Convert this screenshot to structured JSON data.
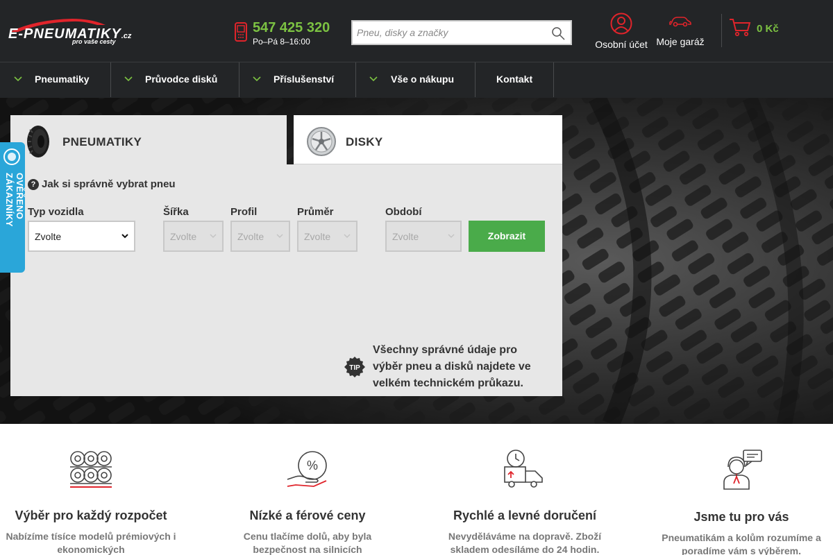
{
  "header": {
    "logo_text": "E-PNEUMATIKY",
    "logo_tld": ".cz",
    "logo_slogan": "pro vaše cesty",
    "phone_number": "547 425 320",
    "phone_hours": "Po–Pá 8–16:00",
    "search_placeholder": "Pneu, disky a značky",
    "account_label": "Osobní účet",
    "garage_label": "Moje garáž",
    "cart_total": "0 Kč"
  },
  "nav": {
    "items": [
      {
        "label": "Pneumatiky"
      },
      {
        "label": "Průvodce disků"
      },
      {
        "label": "Příslušenství"
      },
      {
        "label": "Vše o nákupu"
      },
      {
        "label": "Kontakt"
      }
    ]
  },
  "tabs": {
    "tyres": "PNEUMATIKY",
    "wheels": "DISKY"
  },
  "form": {
    "howto": "Jak si správně vybrat pneu",
    "vehicle_type_label": "Typ vozidla",
    "vehicle_type_value": "Zvolte",
    "width_label": "Šířka",
    "width_value": "Zvolte",
    "profile_label": "Profil",
    "profile_value": "Zvolte",
    "diameter_label": "Průměr",
    "diameter_value": "Zvolte",
    "season_label": "Období",
    "season_value": "Zvolte",
    "submit_label": "Zobrazit",
    "tip_badge": "TIP",
    "tip_text": "Všechny správné údaje pro výběr pneu a disků najdete ve velkém technickém průkazu."
  },
  "badge": {
    "text": "OVĚŘENO ZÁKAZNÍKY"
  },
  "features": [
    {
      "title": "Výběr pro každý rozpočet",
      "text": "Nabízíme tísíce modelů prémiových i ekonomických"
    },
    {
      "title": "Nízké a férové ceny",
      "text": "Cenu tlačíme dolů, aby byla bezpečnost na silnicích"
    },
    {
      "title": "Rychlé a levné doručení",
      "text": "Nevyděláváme na dopravě. Zboží skladem odesíláme do 24 hodin."
    },
    {
      "title": "Jsme tu pro vás",
      "text": "Pneumatikám a kolům rozumíme a poradíme vám s výběrem."
    }
  ],
  "colors": {
    "header_bg": "#232527",
    "accent_green": "#7cc242",
    "button_green": "#4aab4a",
    "badge_blue": "#2aa6d9",
    "panel_bg": "#e7e7e7"
  },
  "icons": {
    "search": "search-icon",
    "account": "user-icon",
    "garage": "car-icon",
    "cart": "cart-icon",
    "phone": "phone-icon"
  }
}
